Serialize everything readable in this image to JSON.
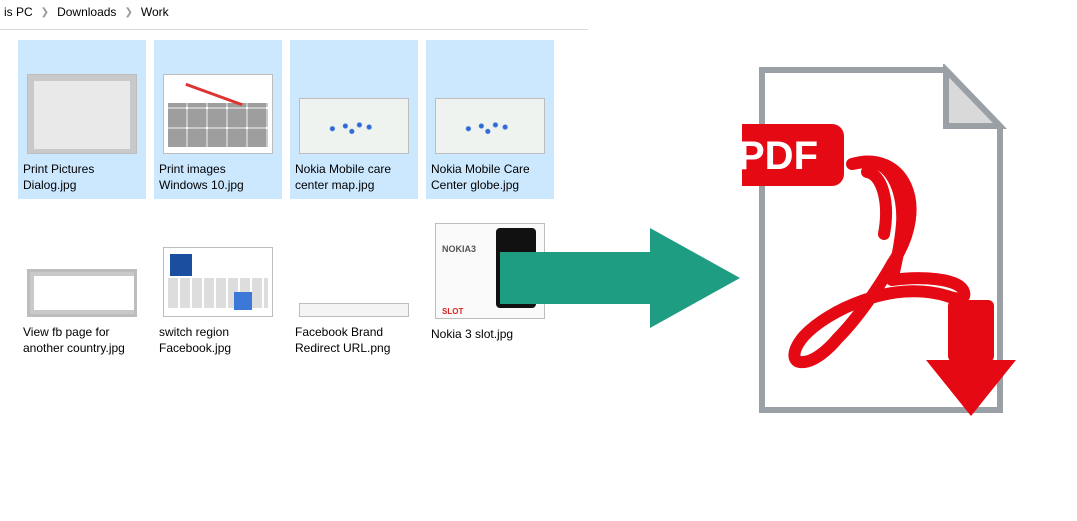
{
  "breadcrumb": {
    "parts": [
      "is PC",
      "Downloads",
      "Work"
    ]
  },
  "files": [
    {
      "label": "Print Pictures Dialog.jpg",
      "selected": true,
      "thumb": "thumb-dialog"
    },
    {
      "label": "Print images Windows 10.jpg",
      "selected": true,
      "thumb": "thumb-printimg"
    },
    {
      "label": "Nokia Mobile care center map.jpg",
      "selected": true,
      "thumb": "thumb-map1"
    },
    {
      "label": "Nokia Mobile Care Center globe.jpg",
      "selected": true,
      "thumb": "thumb-map2"
    },
    {
      "label": "View fb page for another country.jpg",
      "selected": false,
      "thumb": "thumb-fbview"
    },
    {
      "label": "switch region Facebook.jpg",
      "selected": false,
      "thumb": "thumb-switch"
    },
    {
      "label": "Facebook Brand Redirect URL.png",
      "selected": false,
      "thumb": "thumb-url"
    },
    {
      "label": "Nokia 3 slot.jpg",
      "selected": false,
      "thumb": "thumb-nokia3"
    }
  ],
  "arrow": {
    "color": "#1f9d82"
  },
  "pdf": {
    "badge_text": "PDF",
    "badge_color": "#e50914",
    "page_border": "#9aa0a6",
    "download_color": "#e50914"
  }
}
